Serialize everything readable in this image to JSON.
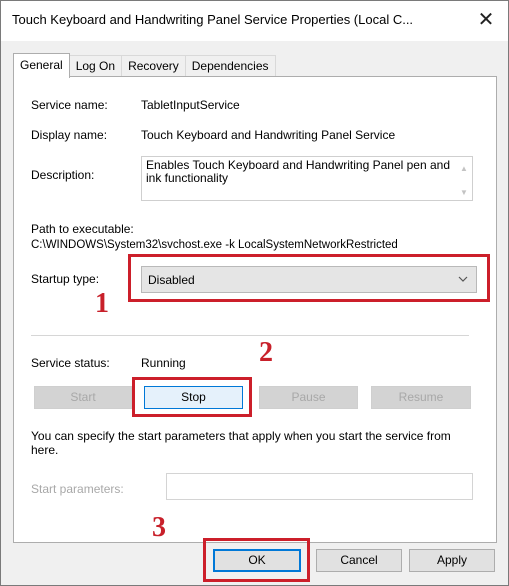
{
  "window": {
    "title": "Touch Keyboard and Handwriting Panel Service Properties (Local C...",
    "close_glyph": "✕"
  },
  "tabs": [
    {
      "label": "General",
      "active": true
    },
    {
      "label": "Log On",
      "active": false
    },
    {
      "label": "Recovery",
      "active": false
    },
    {
      "label": "Dependencies",
      "active": false
    }
  ],
  "general": {
    "service_name_label": "Service name:",
    "service_name_value": "TabletInputService",
    "display_name_label": "Display name:",
    "display_name_value": "Touch Keyboard and Handwriting Panel Service",
    "description_label": "Description:",
    "description_value": "Enables Touch Keyboard and Handwriting Panel pen and ink functionality",
    "path_label": "Path to executable:",
    "path_value": "C:\\WINDOWS\\System32\\svchost.exe -k LocalSystemNetworkRestricted",
    "startup_type_label": "Startup type:",
    "startup_type_value": "Disabled",
    "service_status_label": "Service status:",
    "service_status_value": "Running",
    "buttons": {
      "start": "Start",
      "stop": "Stop",
      "pause": "Pause",
      "resume": "Resume"
    },
    "info_text": "You can specify the start parameters that apply when you start the service from here.",
    "start_params_label": "Start parameters:",
    "start_params_value": ""
  },
  "footer": {
    "ok": "OK",
    "cancel": "Cancel",
    "apply": "Apply"
  },
  "annotations": [
    {
      "number": "1"
    },
    {
      "number": "2"
    },
    {
      "number": "3"
    }
  ],
  "colors": {
    "highlight": "#cc1f2a",
    "focus_blue": "#0078d7"
  }
}
